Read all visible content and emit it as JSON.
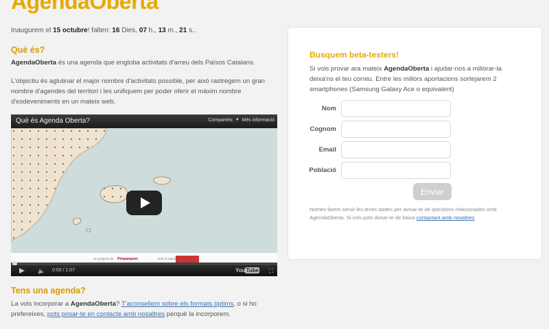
{
  "app": {
    "logo": "AgendaOberta"
  },
  "launch": {
    "prefix": "Inaugurem el ",
    "date": "15 octubre",
    "mid": "! falten: ",
    "days": "16",
    "days_unit": " Dies, ",
    "hours": "07",
    "hours_unit": " h., ",
    "minutes": "13",
    "minutes_unit": " m., ",
    "seconds": "21",
    "seconds_unit": " s.."
  },
  "about": {
    "heading": "Què és?",
    "brand": "AgendaOberta",
    "desc": " és una agenda que engloba activitats d'arreu dels Països Catalans.",
    "goal": "L'objectiu és aglutinar el major nombre d'activitats possible, per això rastregem un gran nombre d'agendes del territori i les unifiquem per poder oferir el màxim nombre d'esdeveniments en un mateix web."
  },
  "video": {
    "title": "Què és Agenda Oberta?",
    "share_label": "Comparteix",
    "more_label": "Més informació",
    "time": "0:00 / 1:07",
    "youtube_label_a": "You",
    "youtube_label_b": "Tube",
    "credit_left": "Un projecte de",
    "credit_logo1": "Pimpampum",
    "credit_mid": "Amb el suport de",
    "progress_fraction": 0
  },
  "agenda": {
    "heading": "Tens una agenda?",
    "t1": "La vols incorporar a ",
    "brand": "AgendaOberta",
    "t2": "? ",
    "link1": "T'aconsellem sobre els formats òptims",
    "t3": ", o si ho prefereixes, ",
    "link2": "pots posar-te en contacte amb nosaltres",
    "t4": " perquè la incorporem."
  },
  "beta": {
    "title": "Busquem beta-testers!",
    "i1": "Si vols provar ara mateix ",
    "brand": "AgendaOberta",
    "i2": " i ajudar-nos a millorar-la deixa'ns el teu correu. Entre les millors aportacions sortejarem 2 smartphones (Samsung Galaxy Ace o equivalent)",
    "fields": {
      "name_label": "Nom",
      "name_value": "",
      "surname_label": "Cognom",
      "surname_value": "",
      "email_label": "Email",
      "email_value": "",
      "town_label": "Població",
      "town_value": ""
    },
    "submit_label": "Enviar",
    "note_text": "Només farem servir les teves dades per avisar-te de qüestions relacionades amb AgendaOberta. Si vols pots donar-te de baixa ",
    "note_link": "contactant amb nosaltres"
  },
  "colors": {
    "accent": "#e8a800",
    "heading": "#d99a00",
    "link": "#3a6fb0",
    "button_disabled": "#cfcfcf"
  },
  "icons": [
    "play-icon",
    "volume-icon",
    "fullscreen-icon",
    "more-info-icon"
  ]
}
